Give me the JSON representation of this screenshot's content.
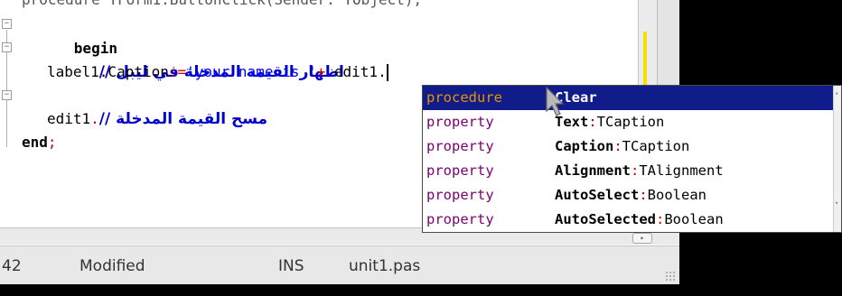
{
  "editor": {
    "top_cut_line": "procedure TForm1.ButtonClick(Sender: TObject);",
    "lines": [
      {
        "kw": "begin"
      },
      {
        "comment": "// اظهار القيمة المدخلة في ليبل"
      },
      {
        "ident": "label1.Caption",
        "sym": ":=",
        "str": "'your name is '",
        "op": "+",
        "tail": " edit1."
      },
      {
        "comment": "// مسح القيمة المدخلة"
      },
      {
        "ident": "edit1",
        "sym": "."
      },
      {
        "kw": "end",
        "sym": ";"
      }
    ]
  },
  "completion": {
    "items": [
      {
        "kind": "procedure",
        "name": "Clear",
        "type": ""
      },
      {
        "kind": "property",
        "name": "Text",
        "type": "TCaption"
      },
      {
        "kind": "property",
        "name": "Caption",
        "type": "TCaption"
      },
      {
        "kind": "property",
        "name": "Alignment",
        "type": "TAlignment"
      },
      {
        "kind": "property",
        "name": "AutoSelect",
        "type": "Boolean"
      },
      {
        "kind": "property",
        "name": "AutoSelected",
        "type": "Boolean"
      }
    ],
    "selected_index": 0
  },
  "status": {
    "position": "42",
    "modified": "Modified",
    "mode": "INS",
    "file": "unit1.pas"
  },
  "colors": {
    "selection": "#0f1c8a",
    "comment": "#0000cc",
    "string": "#0000ff",
    "symbol": "#cc0000",
    "kind": "#7a0070"
  }
}
